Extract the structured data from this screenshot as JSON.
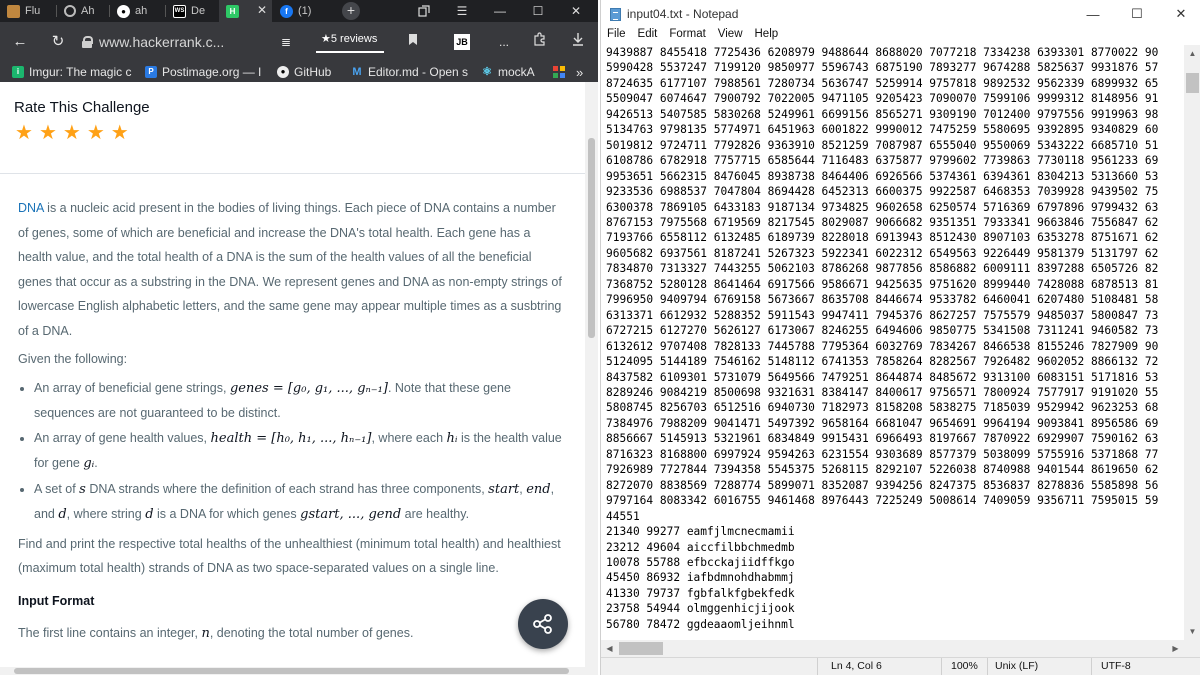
{
  "browser": {
    "tabs": [
      {
        "label": "Flu",
        "icon": "file-icon",
        "color": "#c0873f"
      },
      {
        "label": "Ah",
        "icon": "openai-icon",
        "color": "#555555"
      },
      {
        "label": "ah",
        "icon": "github-icon",
        "color": "#333333"
      },
      {
        "label": "De",
        "icon": "webstorm-icon",
        "color": "#000000"
      },
      {
        "label": "",
        "icon": "hackerrank-icon",
        "color": "#2ec866",
        "active": true
      },
      {
        "label": "(1)",
        "icon": "facebook-icon",
        "color": "#1877f2"
      }
    ],
    "new_tab_label": "+",
    "url": "www.hackerrank.c...",
    "reviews_label": "★5 reviews",
    "more_label": "...",
    "jb_label": "JB",
    "bookmarks": [
      {
        "label": "Imgur: The magic c",
        "icon": "imgur-icon",
        "color": "#1bb76e"
      },
      {
        "label": "Postimage.org — I",
        "icon": "postimage-icon",
        "color": "#2a7ae2"
      },
      {
        "label": "GitHub",
        "icon": "github-icon",
        "color": "#333333"
      },
      {
        "label": "Editor.md - Open s",
        "icon": "editormd-icon",
        "color": "#2196f3"
      },
      {
        "label": "mockA",
        "icon": "react-icon",
        "color": "#61dafb"
      }
    ]
  },
  "page": {
    "rate_title": "Rate This Challenge",
    "rating_stars": 5,
    "dna_word": "DNA",
    "para1_rest": " is a nucleic acid present in the bodies of living things. Each piece of DNA contains a number of genes, some of which are beneficial and increase the DNA's total health. Each gene has a health value, and the total health of a DNA is the sum of the health values of all the beneficial genes that occur as a substring in the DNA. We represent genes and DNA as non-empty strings of lowercase English alphabetic letters, and the same gene may appear multiple times as a susbtring of a DNA.",
    "given": "Given the following:",
    "b1_pre": "An array of beneficial gene strings, ",
    "b1_math": "genes = [g₀, g₁, ..., gₙ₋₁]",
    "b1_post": ". Note that these gene sequences are not guaranteed to be distinct.",
    "b2_pre": "An array of gene health values, ",
    "b2_math": "health = [h₀, h₁, ..., hₙ₋₁]",
    "b2_mid": ", where each ",
    "b2_hi": "hᵢ",
    "b2_mid2": " is the health value for gene ",
    "b2_gi": "gᵢ",
    "b2_post": ".",
    "b3_pre": "A set of ",
    "b3_s": "s",
    "b3_mid": " DNA strands where the definition of each strand has three components, ",
    "b3_start": "start",
    "b3_comma": ", ",
    "b3_end": "end",
    "b3_and": ", and ",
    "b3_d": "d",
    "b3_mid2": ", where string ",
    "b3_d2": "d",
    "b3_mid3": " is a DNA for which genes ",
    "b3_range": "gstart, ..., gend",
    "b3_post": " are healthy.",
    "para2": "Find and print the respective total healths of the unhealthiest (minimum total health) and healthiest (maximum total health) strands of DNA as two space-separated values on a single line.",
    "input_heading": "Input Format",
    "input_pre": "The first line contains an integer, ",
    "input_n": "n",
    "input_post": ", denoting the total number of genes."
  },
  "notepad": {
    "title": "input04.txt - Notepad",
    "menu": [
      "File",
      "Edit",
      "Format",
      "View",
      "Help"
    ],
    "lines": [
      "9439887 8455418 7725436 6208979 9488644 8688020 7077218 7334238 6393301 8770022 90",
      "5990428 5537247 7199120 9850977 5596743 6875190 7893277 9674288 5825637 9931876 57",
      "8724635 6177107 7988561 7280734 5636747 5259914 9757818 9892532 9562339 6899932 65",
      "5509047 6074647 7900792 7022005 9471105 9205423 7090070 7599106 9999312 8148956 91",
      "9426513 5407585 5830268 5249961 6699156 8565271 9309190 7012400 9797556 9919963 98",
      "5134763 9798135 5774971 6451963 6001822 9990012 7475259 5580695 9392895 9340829 60",
      "5019812 9724711 7792826 9363910 8521259 7087987 6555040 9550069 5343222 6685710 51",
      "6108786 6782918 7757715 6585644 7116483 6375877 9799602 7739863 7730118 9561233 69",
      "9953651 5662315 8476045 8938738 8464406 6926566 5374361 6394361 8304213 5313660 53",
      "9233536 6988537 7047804 8694428 6452313 6600375 9922587 6468353 7039928 9439502 75",
      "6300378 7869105 6433183 9187134 9734825 9602658 6250574 5716369 6797896 9799432 63",
      "8767153 7975568 6719569 8217545 8029087 9066682 9351351 7933341 9663846 7556847 62",
      "7193766 6558112 6132485 6189739 8228018 6913943 8512430 8907103 6353278 8751671 62",
      "9605682 6937561 8187241 5267323 5922341 6022312 6549563 9226449 9581379 5131797 62",
      "7834870 7313327 7443255 5062103 8786268 9877856 8586882 6009111 8397288 6505726 82",
      "7368752 5280128 8641464 6917566 9586671 9425635 9751620 8999440 7428088 6878513 81",
      "7996950 9409794 6769158 5673667 8635708 8446674 9533782 6460041 6207480 5108481 58",
      "6313371 6612932 5288352 5911543 9947411 7945376 8627257 7575579 9485037 5800847 73",
      "6727215 6127270 5626127 6173067 8246255 6494606 9850775 5341508 7311241 9460582 73",
      "6132612 9707408 7828133 7445788 7795364 6032769 7834267 8466538 8155246 7827909 90",
      "5124095 5144189 7546162 5148112 6741353 7858264 8282567 7926482 9602052 8866132 72",
      "8437582 6109301 5731079 5649566 7479251 8644874 8485672 9313100 6083151 5171816 53",
      "8289246 9084219 8500698 9321631 8384147 8400617 9756571 7800924 7577917 9191020 55",
      "5808745 8256703 6512516 6940730 7182973 8158208 5838275 7185039 9529942 9623253 68",
      "7384976 7988209 9041471 5497392 9658164 6681047 9654691 9964194 9093841 8956586 69",
      "8856667 5145913 5321961 6834849 9915431 6966493 8197667 7870922 6929907 7590162 63",
      "8716323 8168800 6997924 9594263 6231554 9303689 8577379 5038099 5755916 5371868 77",
      "7926989 7727844 7394358 5545375 5268115 8292107 5226038 8740988 9401544 8619650 62",
      "8272070 8838569 7288774 5899071 8352087 9394256 8247375 8536837 8278836 5585898 56",
      "9797164 8083342 6016755 9461468 8976443 7225249 5008614 7409059 9356711 7595015 59",
      "44551",
      "21340 99277 eamfjlmcnecmamii",
      "23212 49604 aiccfilbbchmedmb",
      "10078 55788 efbcckajiidffkgo",
      "45450 86932 iafbdmnohdhabmmj",
      "41330 79737 fgbfalkfgbekfedk",
      "23758 54944 olmggenhicjijook",
      "56780 78472 ggdeaaomljeihnml"
    ],
    "status": {
      "position": "Ln 4, Col 6",
      "zoom": "100%",
      "line_endings": "Unix (LF)",
      "encoding": "UTF-8"
    }
  }
}
